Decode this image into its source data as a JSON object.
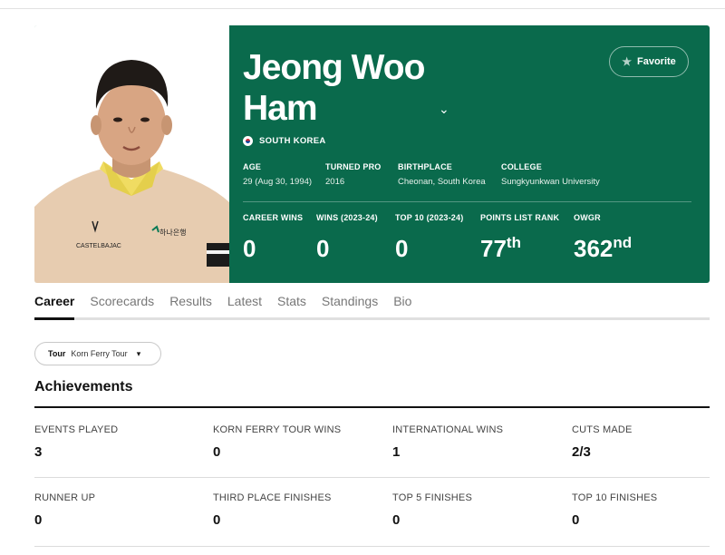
{
  "player": {
    "name": "Jeong Woo Ham",
    "country": "SOUTH KOREA",
    "favorite_label": "Favorite",
    "info": [
      {
        "label": "AGE",
        "value": "29 (Aug 30, 1994)"
      },
      {
        "label": "TURNED PRO",
        "value": "2016"
      },
      {
        "label": "BIRTHPLACE",
        "value": "Cheonan, South Korea"
      },
      {
        "label": "COLLEGE",
        "value": "Sungkyunkwan University"
      }
    ],
    "stats": [
      {
        "label": "CAREER WINS",
        "value": "0",
        "suffix": ""
      },
      {
        "label": "WINS (2023-24)",
        "value": "0",
        "suffix": ""
      },
      {
        "label": "TOP 10 (2023-24)",
        "value": "0",
        "suffix": ""
      },
      {
        "label": "POINTS LIST RANK",
        "value": "77",
        "suffix": "th"
      },
      {
        "label": "OWGR",
        "value": "362",
        "suffix": "nd"
      }
    ]
  },
  "tabs": [
    "Career",
    "Scorecards",
    "Results",
    "Latest",
    "Stats",
    "Standings",
    "Bio"
  ],
  "tour_filter": {
    "label": "Tour",
    "value": "Korn Ferry Tour"
  },
  "achievements": {
    "title": "Achievements",
    "items": [
      {
        "label": "EVENTS PLAYED",
        "value": "3"
      },
      {
        "label": "KORN FERRY TOUR WINS",
        "value": "0"
      },
      {
        "label": "INTERNATIONAL WINS",
        "value": "1"
      },
      {
        "label": "CUTS MADE",
        "value": "2/3"
      },
      {
        "label": "RUNNER UP",
        "value": "0"
      },
      {
        "label": "THIRD PLACE FINISHES",
        "value": "0"
      },
      {
        "label": "TOP 5 FINISHES",
        "value": "0"
      },
      {
        "label": "TOP 10 FINISHES",
        "value": "0"
      }
    ]
  },
  "shirt_logos": {
    "brand": "CASTELBAJAC",
    "sponsor": "하나은행"
  },
  "icons": {
    "favorite": "star-icon",
    "name_toggle": "chevron-down-icon",
    "tour_dropdown": "chevron-down-icon",
    "flag": "south-korea-flag-icon"
  },
  "colors": {
    "hero_bg": "#0a6a4c",
    "text_dark": "#111111"
  }
}
